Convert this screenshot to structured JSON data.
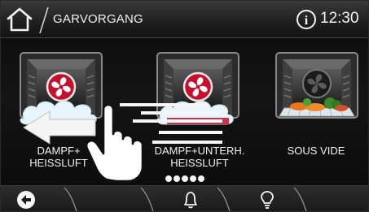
{
  "header": {
    "title": "GARVORGANG",
    "time": "12:30",
    "home_icon": "home-icon",
    "info_icon": "info-icon"
  },
  "modes": [
    {
      "label": "DAMPF+\nHEISSLUFT",
      "icon": "convection-fan-steam-icon"
    },
    {
      "label": "DAMPF+UNTERH.\nHEISSLUFT",
      "icon": "convection-fan-bottom-heat-steam-icon"
    },
    {
      "label": "SOUS VIDE",
      "icon": "sous-vide-vegetables-icon"
    }
  ],
  "pager": {
    "pages": 5
  },
  "footer": {
    "back_icon": "back-arrow-icon",
    "timer_icon": "bell-icon",
    "light_icon": "light-bulb-icon"
  },
  "overlay": {
    "gesture": "swipe-left-hand-icon"
  },
  "colors": {
    "fan_red": "#c8102e",
    "steam": "#e8f4fb",
    "background": "#0d0d0d",
    "text": "#f2f2f2"
  }
}
